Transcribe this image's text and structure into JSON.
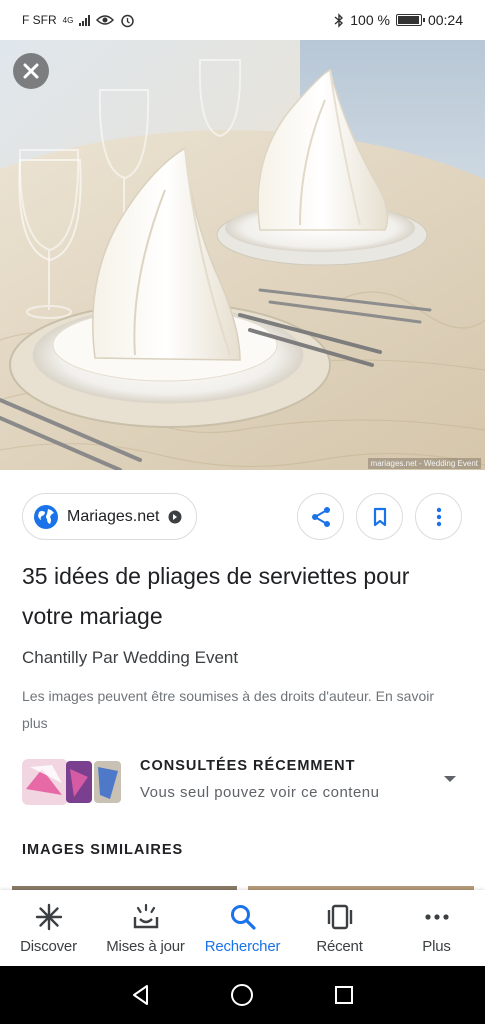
{
  "status_bar": {
    "carrier": "F SFR",
    "network": "4G",
    "battery": "100 %",
    "time": "00:24",
    "battery_level": 1.0
  },
  "hero": {
    "alt": "napkin folding place setting",
    "credit": "mariages.net - Wedding Event"
  },
  "source": {
    "name": "Mariages.net",
    "icon": "globe-icon"
  },
  "actions": {
    "share_icon": "share-icon",
    "bookmark_icon": "bookmark-icon",
    "more_icon": "more-vert-icon"
  },
  "result": {
    "title": "35 idées de pliages de serviettes pour votre mariage",
    "subtitle": "Chantilly Par Wedding Event",
    "copyright": "Les images peuvent être soumises à des droits d'auteur. En savoir plus"
  },
  "recent": {
    "heading": "CONSULTÉES RÉCEMMENT",
    "description": "Vous seul pouvez voir ce contenu"
  },
  "similar": {
    "heading": "IMAGES SIMILAIRES"
  },
  "bottom_nav": {
    "items": [
      {
        "label": "Discover",
        "icon": "asterisk-icon",
        "active": false
      },
      {
        "label": "Mises à jour",
        "icon": "updates-icon",
        "active": false
      },
      {
        "label": "Rechercher",
        "icon": "search-icon",
        "active": true
      },
      {
        "label": "Récent",
        "icon": "tabs-icon",
        "active": false
      },
      {
        "label": "Plus",
        "icon": "more-horiz-icon",
        "active": false
      }
    ]
  },
  "colors": {
    "accent": "#1a73e8",
    "text": "#202124",
    "muted": "#70757a"
  }
}
